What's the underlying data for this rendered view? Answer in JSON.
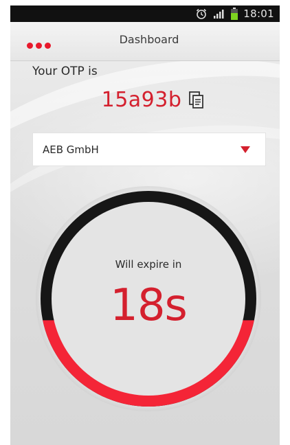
{
  "status_bar": {
    "time": "18:01",
    "icons": [
      "alarm-icon",
      "signal-icon",
      "battery-icon"
    ]
  },
  "header": {
    "title": "Dashboard",
    "menu_icon": "more-dots-icon"
  },
  "otp": {
    "label": "Your OTP is",
    "value": "15a93b",
    "copy_icon": "copy-icon"
  },
  "account_select": {
    "selected": "AEB GmbH",
    "arrow_icon": "dropdown-triangle-icon"
  },
  "timer": {
    "label": "Will expire in",
    "value": "18s",
    "remaining_fraction": 0.4,
    "colors": {
      "remaining": "#f42537",
      "elapsed": "#161616",
      "face": "#e4e4e4"
    }
  },
  "colors": {
    "accent": "#d4202e",
    "status_bar": "#111111"
  }
}
